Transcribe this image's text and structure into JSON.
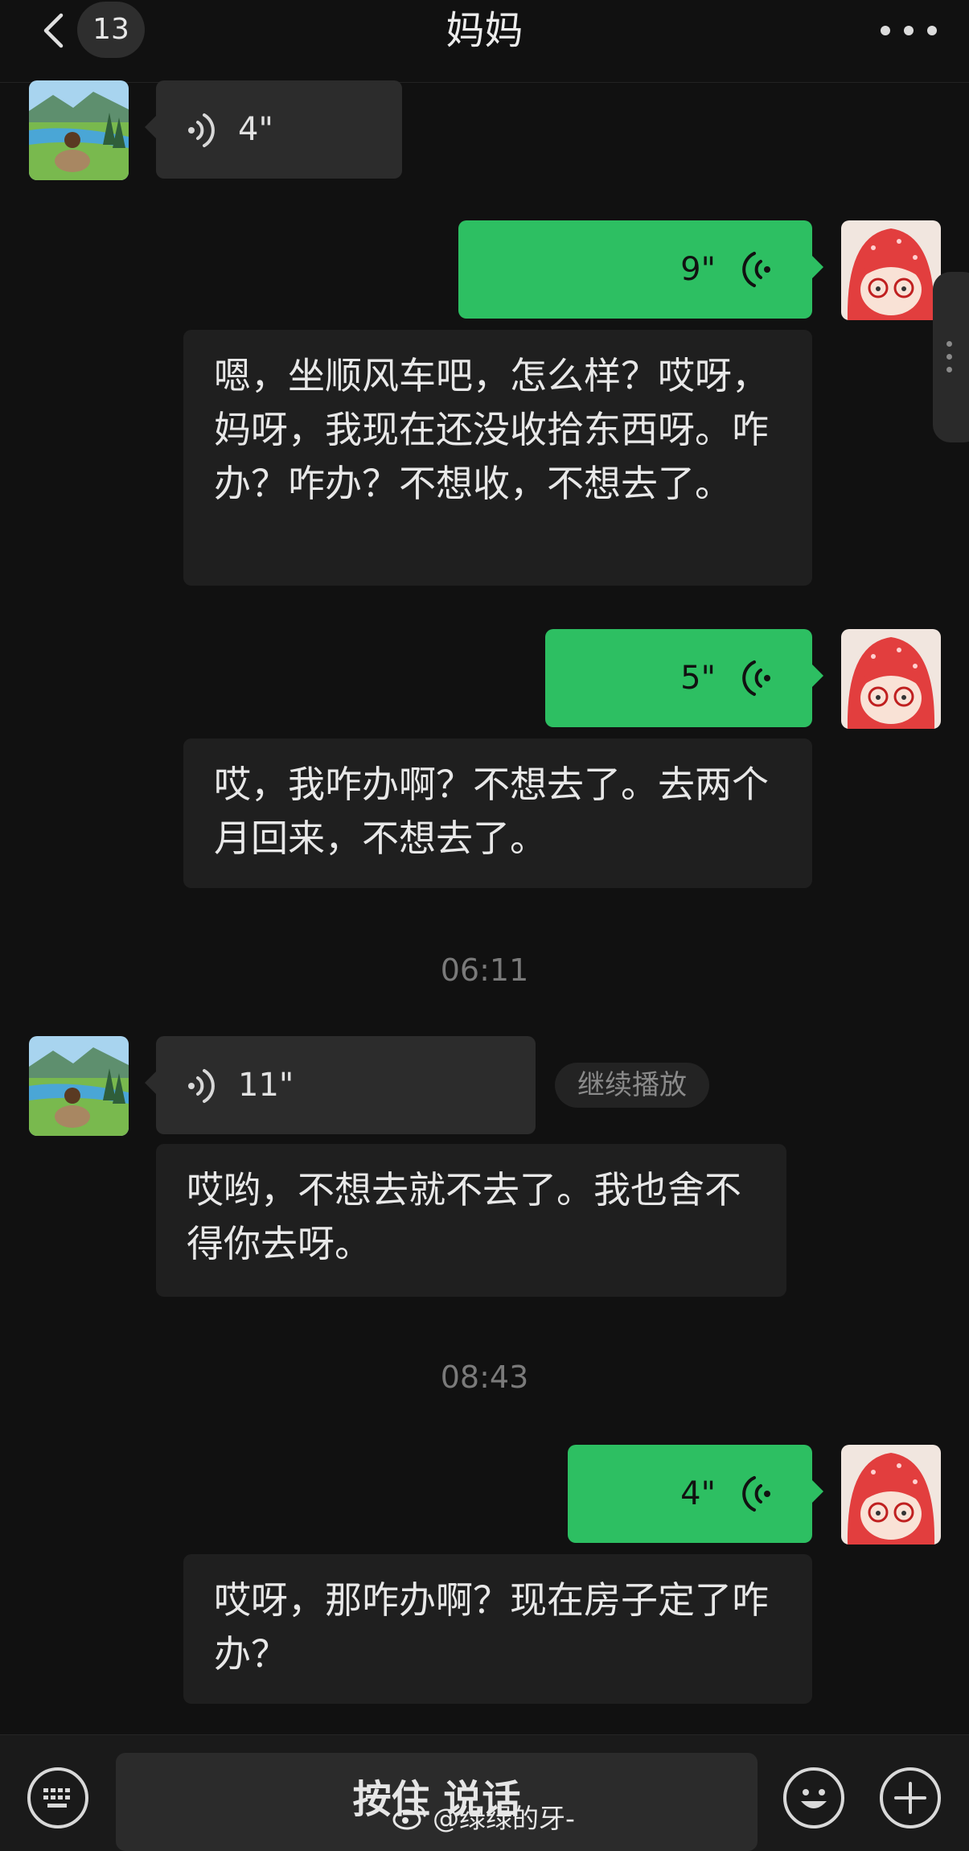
{
  "header": {
    "back_count": "13",
    "title": "妈妈"
  },
  "messages": [
    {
      "duration": "4\""
    },
    {
      "duration": "9\"",
      "transcript": "嗯，坐顺风车吧，怎么样？哎呀，妈呀，我现在还没收拾东西呀。咋办？咋办？不想收，不想去了。"
    },
    {
      "duration": "5\"",
      "transcript": "哎，我咋办啊？不想去了。去两个月回来，不想去了。"
    },
    {
      "duration": "11\"",
      "continue_label": "继续播放",
      "transcript": "哎哟，不想去就不去了。我也舍不得你去呀。"
    },
    {
      "duration": "4\"",
      "transcript": "哎呀，那咋办啊？现在房子定了咋办？"
    }
  ],
  "timestamps": [
    "06:11",
    "08:43"
  ],
  "bottom": {
    "hold_to_talk": "按住 说话",
    "watermark": "@绿绿的牙-"
  },
  "colors": {
    "outgoing_bubble": "#2dbf62",
    "incoming_bubble": "#2c2c2c",
    "background": "#111111"
  },
  "icons": [
    "back-chevron-icon",
    "more-icon",
    "voice-wave-icon",
    "keyboard-icon",
    "emoji-icon",
    "plus-icon",
    "weibo-icon"
  ]
}
